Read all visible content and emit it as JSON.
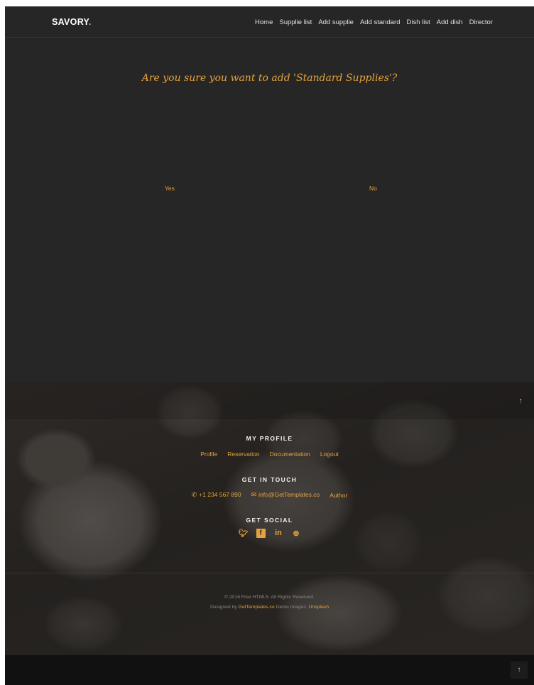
{
  "brand": {
    "name": "SAVORY",
    "dot": ".",
    "accent_color": "#e6a23c"
  },
  "nav": [
    "Home",
    "Supplie list",
    "Add supplie",
    "Add standard",
    "Dish list",
    "Add dish",
    "Director"
  ],
  "confirm": {
    "question": "Are you sure you want to add 'Standard Supplies'?",
    "yes_label": "Yes",
    "no_label": "No"
  },
  "footer": {
    "profile_heading": "MY PROFILE",
    "profile_links": [
      "Profile",
      "Reservation",
      "Documentation",
      "Logout"
    ],
    "touch_heading": "GET IN TOUCH",
    "phone": "+1 234 567 890",
    "phone_icon": "phone-icon",
    "email": "info@GetTemplates.co",
    "email_icon": "envelope-icon",
    "author": "Author",
    "social_heading": "GET SOCIAL",
    "social_icons": [
      "twitter-icon",
      "facebook-icon",
      "linkedin-icon",
      "dribbble-icon"
    ],
    "copyright": "© 2016 Free HTML5. All Rights Reserved.",
    "designed_by_prefix": "Designed by",
    "designer": "GetTemplates.co",
    "demo_images_prefix": "Demo Images:",
    "demo_images_source": "Unsplash"
  },
  "back_to_top_icon": "arrow-up-icon"
}
